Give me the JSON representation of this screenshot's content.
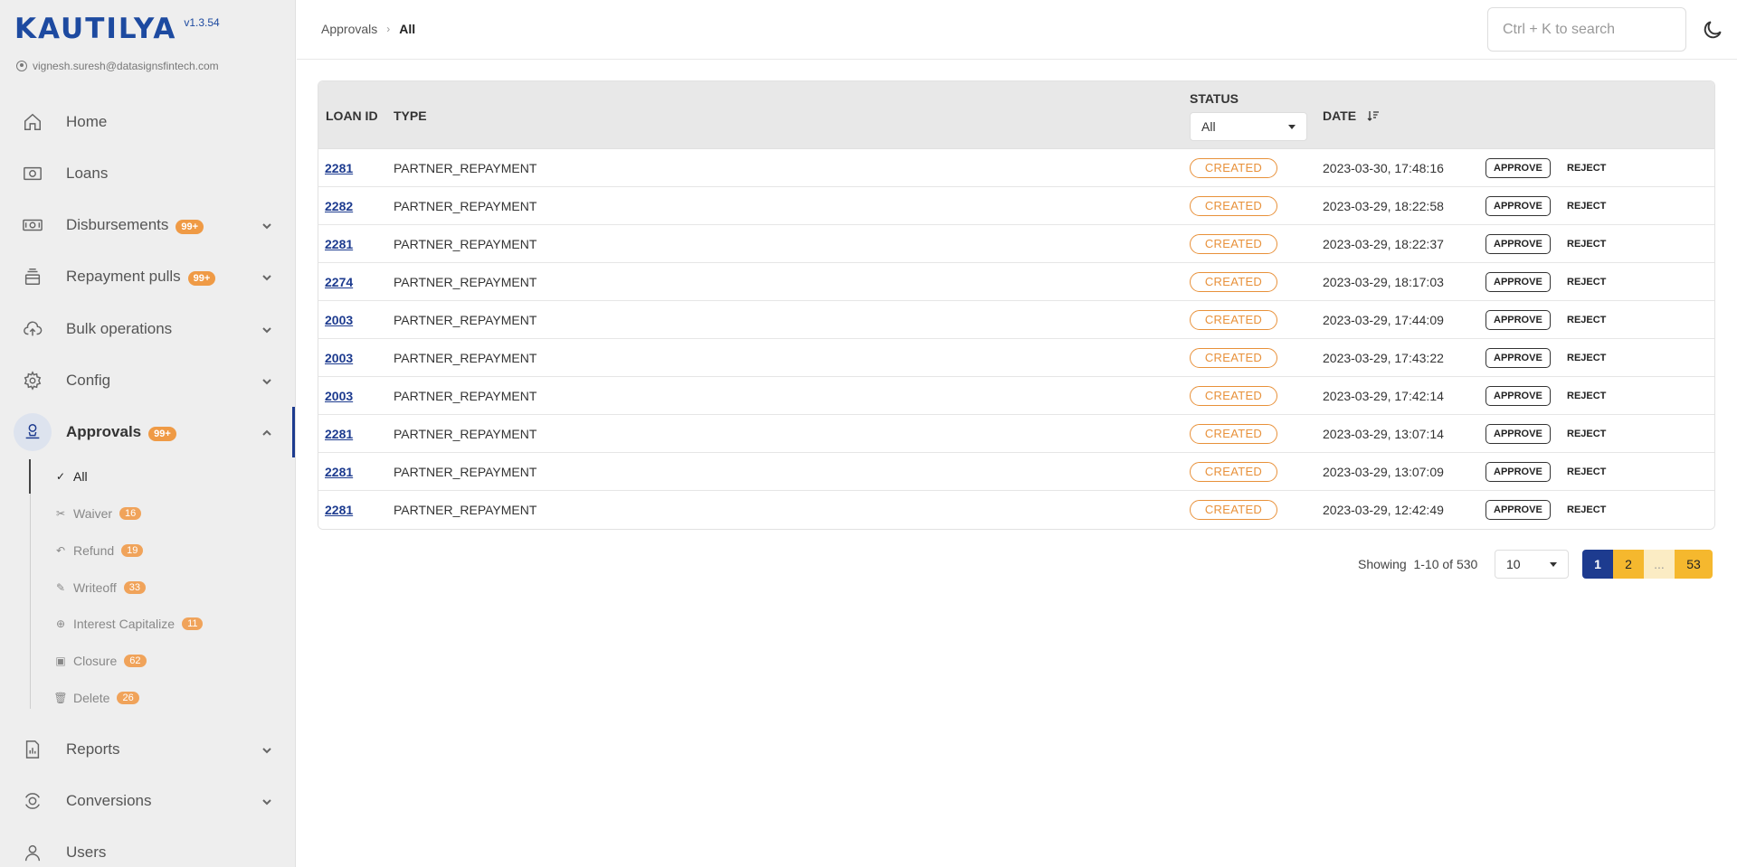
{
  "app": {
    "logo_text": "KAUTILYA",
    "version": "v1.3.54",
    "user_email": "vignesh.suresh@datasignsfintech.com"
  },
  "sidebar": {
    "items": [
      {
        "label": "Home",
        "icon": "home-icon"
      },
      {
        "label": "Loans",
        "icon": "loans-icon"
      },
      {
        "label": "Disbursements",
        "badge": "99+",
        "icon": "disbursements-icon"
      },
      {
        "label": "Repayment pulls",
        "badge": "99+",
        "icon": "repayment-icon"
      },
      {
        "label": "Bulk operations",
        "icon": "cloud-upload-icon"
      },
      {
        "label": "Config",
        "icon": "gear-icon"
      },
      {
        "label": "Approvals",
        "badge": "99+",
        "icon": "approvals-icon"
      },
      {
        "label": "Reports",
        "icon": "reports-icon"
      },
      {
        "label": "Conversions",
        "icon": "conversions-icon"
      },
      {
        "label": "Users",
        "icon": "user-icon"
      }
    ],
    "approvals_sub": [
      {
        "label": "All",
        "icon": "check-double-icon"
      },
      {
        "label": "Waiver",
        "badge": "16",
        "icon": "scissors-icon"
      },
      {
        "label": "Refund",
        "badge": "19",
        "icon": "undo-icon"
      },
      {
        "label": "Writeoff",
        "badge": "33",
        "icon": "pencil-icon"
      },
      {
        "label": "Interest Capitalize",
        "badge": "11",
        "icon": "plus-circle-icon"
      },
      {
        "label": "Closure",
        "badge": "62",
        "icon": "clipboard-icon"
      },
      {
        "label": "Delete",
        "badge": "26",
        "icon": "trash-icon"
      }
    ]
  },
  "header": {
    "breadcrumb": [
      "Approvals",
      "All"
    ],
    "search_placeholder": "Ctrl + K to search"
  },
  "table": {
    "columns": {
      "loan_id": "LOAN ID",
      "type": "TYPE",
      "status": "STATUS",
      "date": "DATE"
    },
    "status_filter": "All",
    "approve_label": "APPROVE",
    "reject_label": "REJECT",
    "rows": [
      {
        "loan_id": "2281",
        "type": "PARTNER_REPAYMENT",
        "status": "CREATED",
        "date": "2023-03-30, 17:48:16"
      },
      {
        "loan_id": "2282",
        "type": "PARTNER_REPAYMENT",
        "status": "CREATED",
        "date": "2023-03-29, 18:22:58"
      },
      {
        "loan_id": "2281",
        "type": "PARTNER_REPAYMENT",
        "status": "CREATED",
        "date": "2023-03-29, 18:22:37"
      },
      {
        "loan_id": "2274",
        "type": "PARTNER_REPAYMENT",
        "status": "CREATED",
        "date": "2023-03-29, 18:17:03"
      },
      {
        "loan_id": "2003",
        "type": "PARTNER_REPAYMENT",
        "status": "CREATED",
        "date": "2023-03-29, 17:44:09"
      },
      {
        "loan_id": "2003",
        "type": "PARTNER_REPAYMENT",
        "status": "CREATED",
        "date": "2023-03-29, 17:43:22"
      },
      {
        "loan_id": "2003",
        "type": "PARTNER_REPAYMENT",
        "status": "CREATED",
        "date": "2023-03-29, 17:42:14"
      },
      {
        "loan_id": "2281",
        "type": "PARTNER_REPAYMENT",
        "status": "CREATED",
        "date": "2023-03-29, 13:07:14"
      },
      {
        "loan_id": "2281",
        "type": "PARTNER_REPAYMENT",
        "status": "CREATED",
        "date": "2023-03-29, 13:07:09"
      },
      {
        "loan_id": "2281",
        "type": "PARTNER_REPAYMENT",
        "status": "CREATED",
        "date": "2023-03-29, 12:42:49"
      }
    ]
  },
  "pagination": {
    "showing_label": "Showing",
    "range": "1-10 of 530",
    "page_size": "10",
    "pages": [
      "1",
      "2",
      "...",
      "53"
    ]
  },
  "colors": {
    "brand_blue": "#1d3b8f",
    "accent_orange": "#e8913a",
    "pager_yellow": "#f5b82e"
  }
}
